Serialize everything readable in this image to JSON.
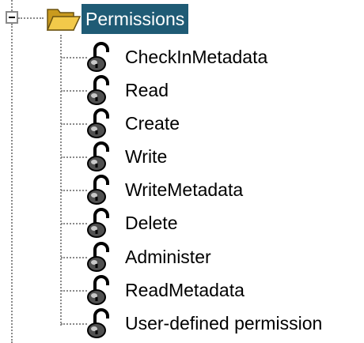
{
  "tree": {
    "root": {
      "label": "Permissions",
      "expanded": true,
      "icon": "folder-open-icon"
    },
    "items": [
      {
        "label": "CheckInMetadata",
        "icon": "lock-open-icon"
      },
      {
        "label": "Read",
        "icon": "lock-open-icon"
      },
      {
        "label": "Create",
        "icon": "lock-open-icon"
      },
      {
        "label": "Write",
        "icon": "lock-open-icon"
      },
      {
        "label": "WriteMetadata",
        "icon": "lock-open-icon"
      },
      {
        "label": "Delete",
        "icon": "lock-open-icon"
      },
      {
        "label": "Administer",
        "icon": "lock-open-icon"
      },
      {
        "label": "ReadMetadata",
        "icon": "lock-open-icon"
      },
      {
        "label": "User-defined permission",
        "icon": "lock-open-icon"
      }
    ]
  },
  "colors": {
    "selection_background": "#1f5b75",
    "selection_text": "#ffffff",
    "guide_lines": "#8a8a8a",
    "folder": "#f2c94a"
  }
}
